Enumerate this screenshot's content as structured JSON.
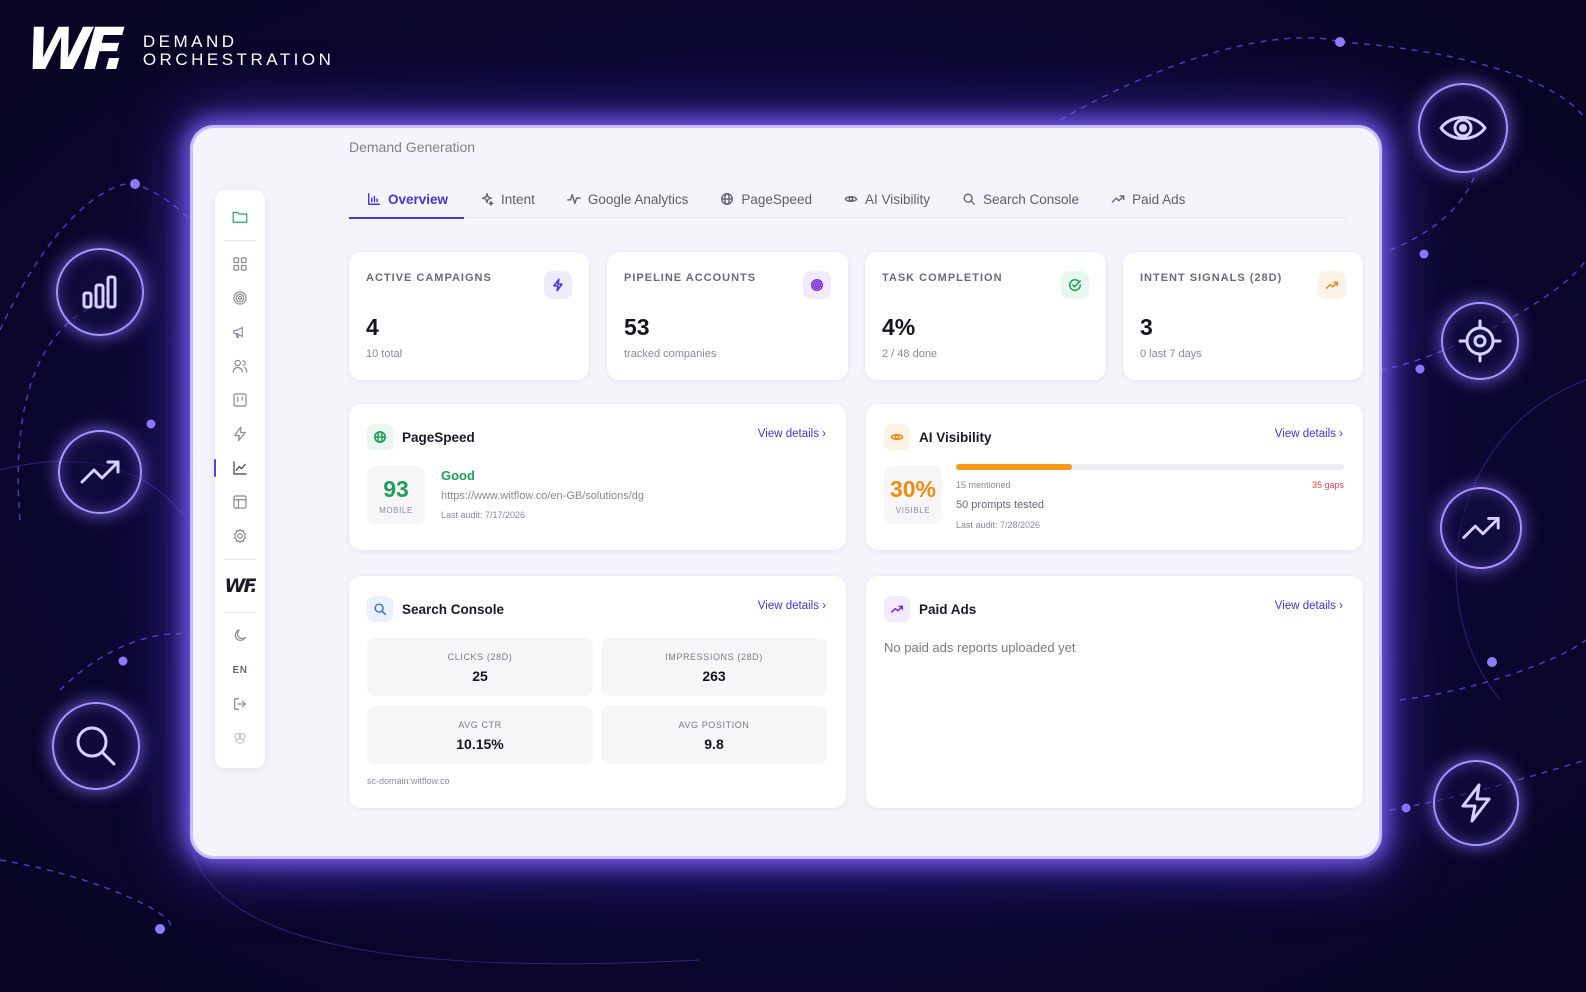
{
  "brand": {
    "mark": "WF.",
    "line1": "DEMAND",
    "line2": "ORCHESTRATION"
  },
  "floating_icons": [
    "bar-chart-icon",
    "trending-up-icon",
    "search-icon",
    "eye-icon",
    "target-icon",
    "trending-up-icon",
    "lightning-icon"
  ],
  "colors": {
    "accent": "#4b32d6",
    "good": "#1e9e5a",
    "warning": "#f08a12",
    "danger": "#e0474c",
    "glow": "#8f73ff"
  },
  "sidebar": {
    "logo": "WF.",
    "language": "EN",
    "items": [
      "folder-icon",
      "dashboard-grid-icon",
      "target-icon",
      "megaphone-icon",
      "users-icon",
      "kanban-icon",
      "lightning-icon",
      "line-chart-icon",
      "layout-icon",
      "gear-icon",
      "moon-icon",
      "logout-icon",
      "brain-icon"
    ],
    "active": "line-chart-icon"
  },
  "page": {
    "breadcrumb": "Demand Generation"
  },
  "tabs": [
    {
      "label": "Overview",
      "icon": "bar-chart-icon"
    },
    {
      "label": "Intent",
      "icon": "sparkle-icon"
    },
    {
      "label": "Google Analytics",
      "icon": "activity-icon"
    },
    {
      "label": "PageSpeed",
      "icon": "globe-icon"
    },
    {
      "label": "AI Visibility",
      "icon": "eye-icon"
    },
    {
      "label": "Search Console",
      "icon": "search-icon"
    },
    {
      "label": "Paid Ads",
      "icon": "trending-up-icon"
    }
  ],
  "active_tab": "Overview",
  "stats": [
    {
      "label": "ACTIVE CAMPAIGNS",
      "value": "4",
      "sub": "10 total",
      "icon": "lightning-icon"
    },
    {
      "label": "PIPELINE ACCOUNTS",
      "value": "53",
      "sub": "tracked companies",
      "icon": "target-icon"
    },
    {
      "label": "TASK COMPLETION",
      "value": "4%",
      "sub": "2 / 48 done",
      "icon": "check-circle-icon"
    },
    {
      "label": "INTENT SIGNALS (28D)",
      "value": "3",
      "sub": "0 last 7 days",
      "icon": "trending-up-icon"
    }
  ],
  "pagespeed": {
    "title": "PageSpeed",
    "link": "View details",
    "score": "93",
    "score_caption": "MOBILE",
    "rating": "Good",
    "url": "https://www.witflow.co/en-GB/solutions/dg",
    "last_audit": "Last audit: 7/17/2026"
  },
  "ai_visibility": {
    "title": "AI Visibility",
    "link": "View details",
    "score": "30%",
    "score_caption": "VISIBLE",
    "progress": 0.3,
    "mentioned": "15 mentioned",
    "gaps": "35 gaps",
    "prompts": "50 prompts tested",
    "last_audit": "Last audit: 7/28/2026"
  },
  "search_console": {
    "title": "Search Console",
    "link": "View details",
    "metrics": [
      {
        "label": "CLICKS (28D)",
        "value": "25"
      },
      {
        "label": "IMPRESSIONS (28D)",
        "value": "263"
      },
      {
        "label": "AVG CTR",
        "value": "10.15%"
      },
      {
        "label": "AVG POSITION",
        "value": "9.8"
      }
    ],
    "domain": "sc-domain:witflow.co"
  },
  "paid_ads": {
    "title": "Paid Ads",
    "link": "View details",
    "empty": "No paid ads reports uploaded yet"
  }
}
